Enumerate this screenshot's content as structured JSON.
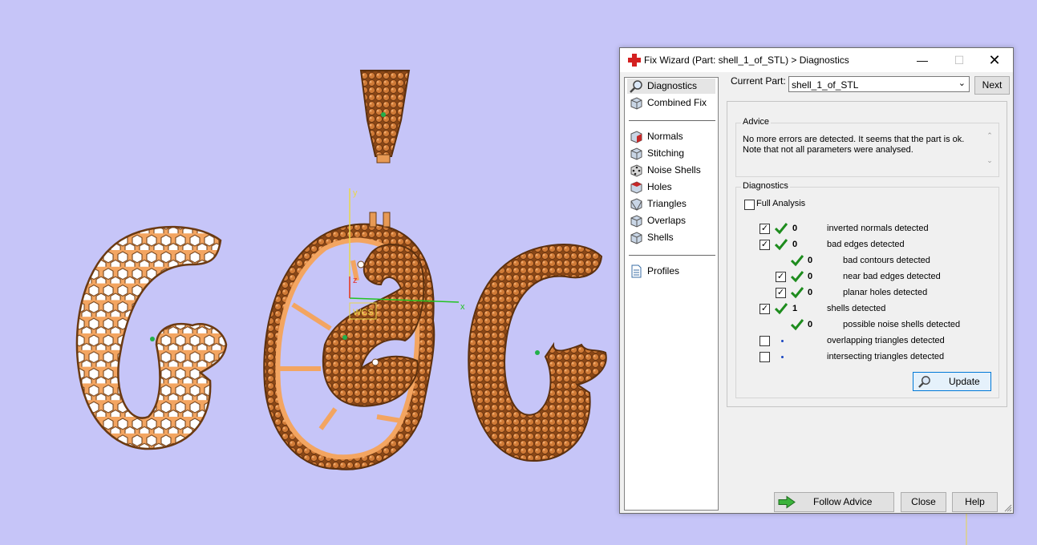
{
  "scene": {
    "axis_y": "y",
    "axis_x": "x",
    "axis_z": "z",
    "wcs_label": "WCS"
  },
  "dialog": {
    "title": "Fix Wizard (Part: shell_1_of_STL) > Diagnostics",
    "nav": {
      "diagnostics": "Diagnostics",
      "combined_fix": "Combined Fix",
      "normals": "Normals",
      "stitching": "Stitching",
      "noise_shells": "Noise Shells",
      "holes": "Holes",
      "triangles": "Triangles",
      "overlaps": "Overlaps",
      "shells": "Shells",
      "profiles": "Profiles"
    },
    "current_part_label": "Current Part:",
    "current_part_value": "shell_1_of_STL",
    "next_label": "Next",
    "advice": {
      "title": "Advice",
      "line1": "No more errors are detected. It seems that the part is ok.",
      "line2": "Note that not all parameters were analysed."
    },
    "diagnostics": {
      "title": "Diagnostics",
      "full_analysis": "Full Analysis",
      "rows": [
        {
          "count": "0",
          "label": "inverted normals detected"
        },
        {
          "count": "0",
          "label": "bad edges detected"
        },
        {
          "count": "0",
          "label": "bad contours detected"
        },
        {
          "count": "0",
          "label": "near bad edges detected"
        },
        {
          "count": "0",
          "label": "planar holes detected"
        },
        {
          "count": "1",
          "label": "shells detected"
        },
        {
          "count": "0",
          "label": "possible noise shells detected"
        },
        {
          "count": "",
          "label": "overlapping triangles detected"
        },
        {
          "count": "",
          "label": "intersecting triangles detected"
        }
      ]
    },
    "update_label": "Update",
    "follow_advice_label": "Follow Advice",
    "close_label": "Close",
    "help_label": "Help"
  },
  "colors": {
    "background": "#c6c5f8",
    "part": "#f3a561",
    "part_outline": "#6b3a12",
    "stone": "#c8742e",
    "axis_y": "#e8d84a",
    "axis_x": "#22c422",
    "check": "#1d8c1d"
  }
}
